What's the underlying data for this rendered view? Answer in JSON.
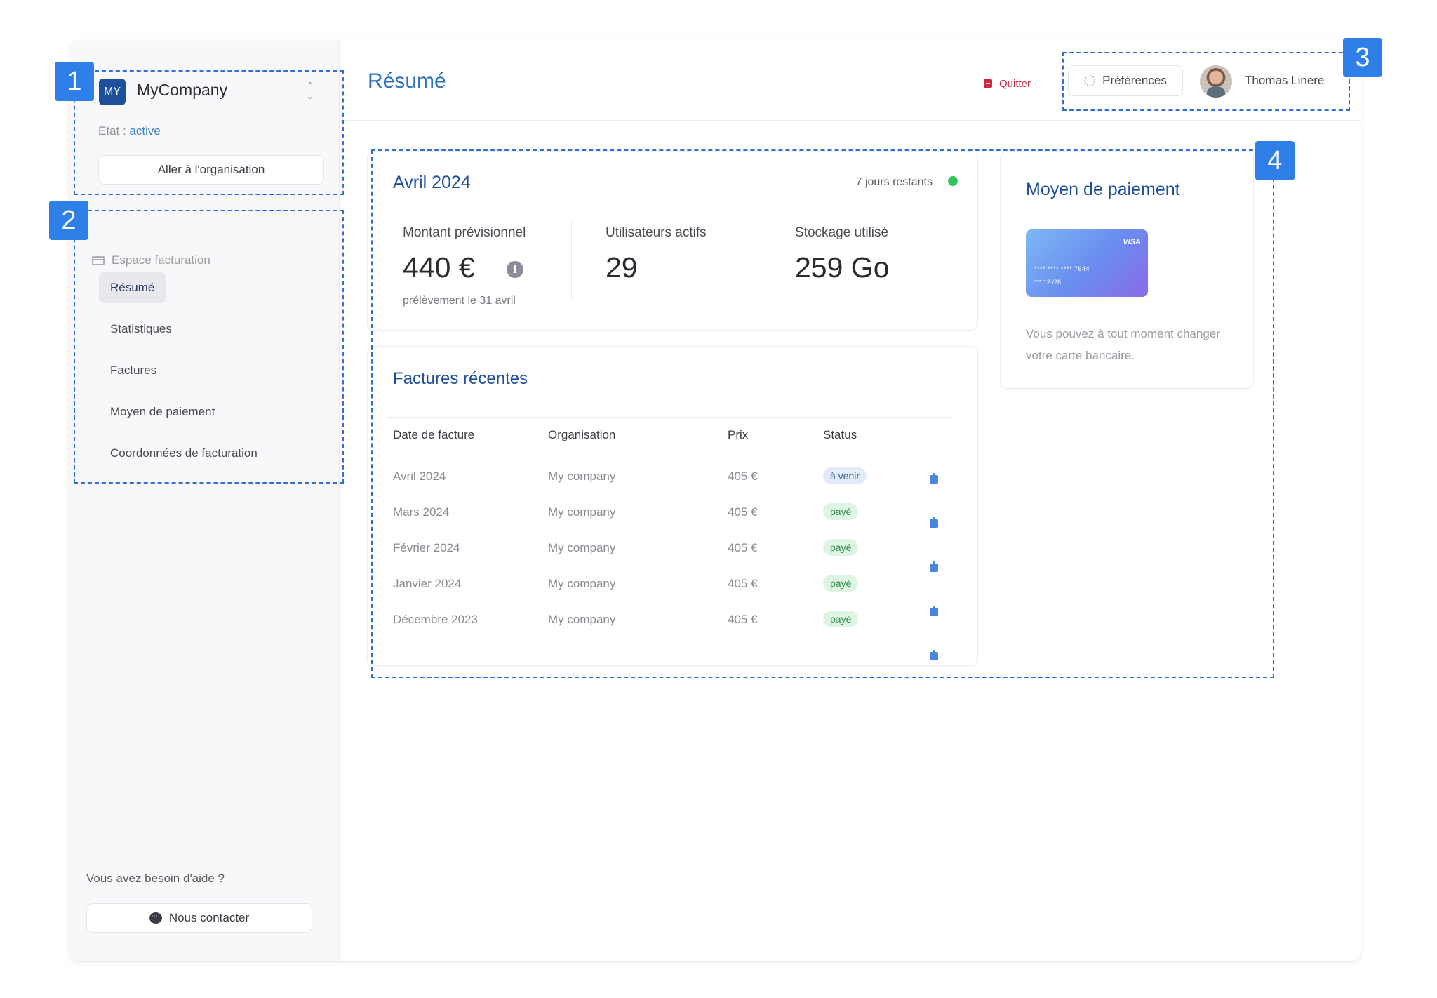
{
  "org": {
    "avatar_initials": "MY",
    "name": "MyCompany",
    "state_label": "Etat :",
    "state_value": "active",
    "goto_label": "Aller à l'organisation"
  },
  "nav": {
    "section_label": "Espace facturation",
    "items": [
      {
        "label": "Résumé",
        "active": true
      },
      {
        "label": "Statistiques"
      },
      {
        "label": "Factures"
      },
      {
        "label": "Moyen de paiement"
      },
      {
        "label": "Coordonnées de facturation"
      }
    ]
  },
  "help": {
    "question": "Vous avez besoin d'aide ?",
    "contact_label": "Nous contacter"
  },
  "header": {
    "title": "Résumé",
    "quit_label": "Quitter",
    "preferences_label": "Préférences",
    "user_name": "Thomas Linere"
  },
  "summary": {
    "period": "Avril 2024",
    "days_left": "7 jours restants",
    "metrics": [
      {
        "label": "Montant prévisionnel",
        "value": "440 €",
        "sub": "prélèvement le 31 avril"
      },
      {
        "label": "Utilisateurs actifs",
        "value": "29"
      },
      {
        "label": "Stockage utilisé",
        "value": "259 Go"
      }
    ]
  },
  "invoices": {
    "title": "Factures récentes",
    "columns": [
      "Date de facture",
      "Organisation",
      "Prix",
      "Status"
    ],
    "rows": [
      {
        "date": "Avril 2024",
        "org": "My company",
        "price": "405 €",
        "status": "à venir"
      },
      {
        "date": "Mars 2024",
        "org": "My company",
        "price": "405 €",
        "status": "payé"
      },
      {
        "date": "Février 2024",
        "org": "My company",
        "price": "405 €",
        "status": "payé"
      },
      {
        "date": "Janvier 2024",
        "org": "My company",
        "price": "405 €",
        "status": "payé"
      },
      {
        "date": "Décembre 2023",
        "org": "My company",
        "price": "405 €",
        "status": "payé"
      }
    ]
  },
  "payment": {
    "title": "Moyen de paiement",
    "card_brand": "VISA",
    "card_number": "**** **** **** 7644",
    "card_expiry": "*** 12 /28",
    "description": "Vous pouvez à tout moment changer votre carte bancaire."
  },
  "annotations": [
    "1",
    "2",
    "3",
    "4"
  ],
  "colors": {
    "accent": "#1d4f9c",
    "title_blue": "#2d6fc0",
    "marker": "#2e7fe8",
    "danger": "#d0283c",
    "success": "#33c45a"
  },
  "icons": [
    "switch-chevrons-icon",
    "credit-card-icon",
    "chat-icon",
    "quit-icon",
    "gear-icon",
    "info-icon",
    "download-icon",
    "status-dot-icon"
  ]
}
